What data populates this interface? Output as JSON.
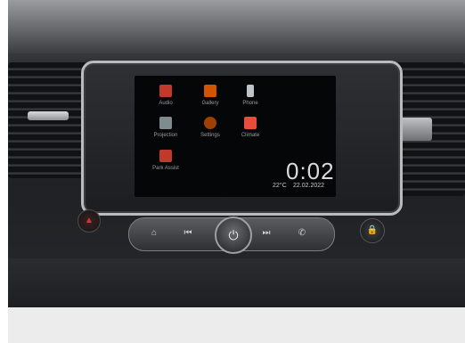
{
  "screen": {
    "apps": [
      {
        "label": "Audio",
        "icon": "audio-icon",
        "color": "#c0392b"
      },
      {
        "label": "Gallery",
        "icon": "gallery-icon",
        "color": "#d35400"
      },
      {
        "label": "Phone",
        "icon": "phone-icon",
        "color": "#bdc3c7"
      },
      {
        "label": "Projection",
        "icon": "projection-icon",
        "color": "#7f8c8d"
      },
      {
        "label": "Settings",
        "icon": "settings-icon",
        "color": "#a04000"
      },
      {
        "label": "Climate",
        "icon": "climate-icon",
        "color": "#e74c3c"
      },
      {
        "label": "Park Assist",
        "icon": "park-assist-icon",
        "color": "#c0392b"
      }
    ],
    "clock": "0:02",
    "temperature": "22°C",
    "date": "22.02.2022"
  },
  "controls": {
    "home_icon": "home-icon",
    "prev_icon": "previous-track-icon",
    "power_icon": "power-volume-knob",
    "next_icon": "next-track-icon",
    "call_icon": "phone-icon",
    "hazard_icon": "hazard-icon",
    "lock_icon": "lock-icon"
  }
}
